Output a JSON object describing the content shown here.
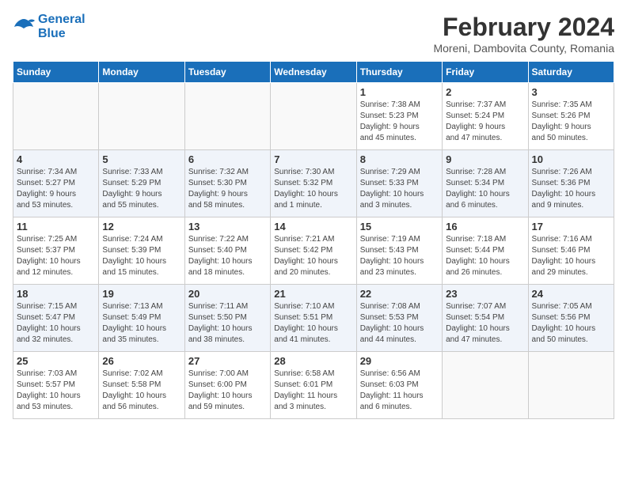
{
  "logo": {
    "line1": "General",
    "line2": "Blue"
  },
  "title": "February 2024",
  "subtitle": "Moreni, Dambovita County, Romania",
  "weekdays": [
    "Sunday",
    "Monday",
    "Tuesday",
    "Wednesday",
    "Thursday",
    "Friday",
    "Saturday"
  ],
  "weeks": [
    [
      {
        "day": "",
        "info": ""
      },
      {
        "day": "",
        "info": ""
      },
      {
        "day": "",
        "info": ""
      },
      {
        "day": "",
        "info": ""
      },
      {
        "day": "1",
        "info": "Sunrise: 7:38 AM\nSunset: 5:23 PM\nDaylight: 9 hours\nand 45 minutes."
      },
      {
        "day": "2",
        "info": "Sunrise: 7:37 AM\nSunset: 5:24 PM\nDaylight: 9 hours\nand 47 minutes."
      },
      {
        "day": "3",
        "info": "Sunrise: 7:35 AM\nSunset: 5:26 PM\nDaylight: 9 hours\nand 50 minutes."
      }
    ],
    [
      {
        "day": "4",
        "info": "Sunrise: 7:34 AM\nSunset: 5:27 PM\nDaylight: 9 hours\nand 53 minutes."
      },
      {
        "day": "5",
        "info": "Sunrise: 7:33 AM\nSunset: 5:29 PM\nDaylight: 9 hours\nand 55 minutes."
      },
      {
        "day": "6",
        "info": "Sunrise: 7:32 AM\nSunset: 5:30 PM\nDaylight: 9 hours\nand 58 minutes."
      },
      {
        "day": "7",
        "info": "Sunrise: 7:30 AM\nSunset: 5:32 PM\nDaylight: 10 hours\nand 1 minute."
      },
      {
        "day": "8",
        "info": "Sunrise: 7:29 AM\nSunset: 5:33 PM\nDaylight: 10 hours\nand 3 minutes."
      },
      {
        "day": "9",
        "info": "Sunrise: 7:28 AM\nSunset: 5:34 PM\nDaylight: 10 hours\nand 6 minutes."
      },
      {
        "day": "10",
        "info": "Sunrise: 7:26 AM\nSunset: 5:36 PM\nDaylight: 10 hours\nand 9 minutes."
      }
    ],
    [
      {
        "day": "11",
        "info": "Sunrise: 7:25 AM\nSunset: 5:37 PM\nDaylight: 10 hours\nand 12 minutes."
      },
      {
        "day": "12",
        "info": "Sunrise: 7:24 AM\nSunset: 5:39 PM\nDaylight: 10 hours\nand 15 minutes."
      },
      {
        "day": "13",
        "info": "Sunrise: 7:22 AM\nSunset: 5:40 PM\nDaylight: 10 hours\nand 18 minutes."
      },
      {
        "day": "14",
        "info": "Sunrise: 7:21 AM\nSunset: 5:42 PM\nDaylight: 10 hours\nand 20 minutes."
      },
      {
        "day": "15",
        "info": "Sunrise: 7:19 AM\nSunset: 5:43 PM\nDaylight: 10 hours\nand 23 minutes."
      },
      {
        "day": "16",
        "info": "Sunrise: 7:18 AM\nSunset: 5:44 PM\nDaylight: 10 hours\nand 26 minutes."
      },
      {
        "day": "17",
        "info": "Sunrise: 7:16 AM\nSunset: 5:46 PM\nDaylight: 10 hours\nand 29 minutes."
      }
    ],
    [
      {
        "day": "18",
        "info": "Sunrise: 7:15 AM\nSunset: 5:47 PM\nDaylight: 10 hours\nand 32 minutes."
      },
      {
        "day": "19",
        "info": "Sunrise: 7:13 AM\nSunset: 5:49 PM\nDaylight: 10 hours\nand 35 minutes."
      },
      {
        "day": "20",
        "info": "Sunrise: 7:11 AM\nSunset: 5:50 PM\nDaylight: 10 hours\nand 38 minutes."
      },
      {
        "day": "21",
        "info": "Sunrise: 7:10 AM\nSunset: 5:51 PM\nDaylight: 10 hours\nand 41 minutes."
      },
      {
        "day": "22",
        "info": "Sunrise: 7:08 AM\nSunset: 5:53 PM\nDaylight: 10 hours\nand 44 minutes."
      },
      {
        "day": "23",
        "info": "Sunrise: 7:07 AM\nSunset: 5:54 PM\nDaylight: 10 hours\nand 47 minutes."
      },
      {
        "day": "24",
        "info": "Sunrise: 7:05 AM\nSunset: 5:56 PM\nDaylight: 10 hours\nand 50 minutes."
      }
    ],
    [
      {
        "day": "25",
        "info": "Sunrise: 7:03 AM\nSunset: 5:57 PM\nDaylight: 10 hours\nand 53 minutes."
      },
      {
        "day": "26",
        "info": "Sunrise: 7:02 AM\nSunset: 5:58 PM\nDaylight: 10 hours\nand 56 minutes."
      },
      {
        "day": "27",
        "info": "Sunrise: 7:00 AM\nSunset: 6:00 PM\nDaylight: 10 hours\nand 59 minutes."
      },
      {
        "day": "28",
        "info": "Sunrise: 6:58 AM\nSunset: 6:01 PM\nDaylight: 11 hours\nand 3 minutes."
      },
      {
        "day": "29",
        "info": "Sunrise: 6:56 AM\nSunset: 6:03 PM\nDaylight: 11 hours\nand 6 minutes."
      },
      {
        "day": "",
        "info": ""
      },
      {
        "day": "",
        "info": ""
      }
    ]
  ]
}
